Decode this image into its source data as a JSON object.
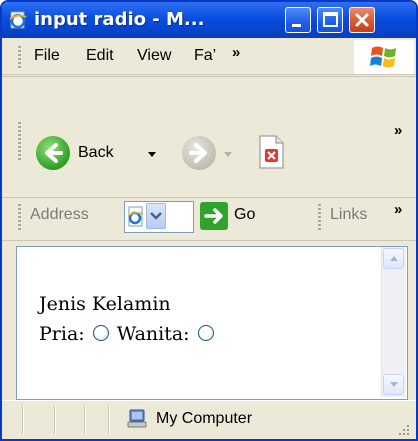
{
  "window": {
    "title": "input radio - M...",
    "colors": {
      "titlebar": "#0a4fe0",
      "chrome": "#ece9d8",
      "close_button": "#d75a35"
    }
  },
  "menu": {
    "items": [
      "File",
      "Edit",
      "View",
      "Fa’"
    ],
    "overflow": "»"
  },
  "toolbar": {
    "back_label": "Back",
    "overflow": "»",
    "icons": [
      "back-arrow-icon",
      "forward-arrow-icon",
      "stop-page-icon"
    ]
  },
  "address_bar": {
    "label": "Address",
    "go_label": "Go",
    "links_label": "Links",
    "overflow": "»"
  },
  "page": {
    "heading": "Jenis Kelamin",
    "options": [
      {
        "label": "Pria:",
        "checked": false
      },
      {
        "label": "Wanita:",
        "checked": false
      }
    ]
  },
  "statusbar": {
    "zone": "My Computer"
  }
}
